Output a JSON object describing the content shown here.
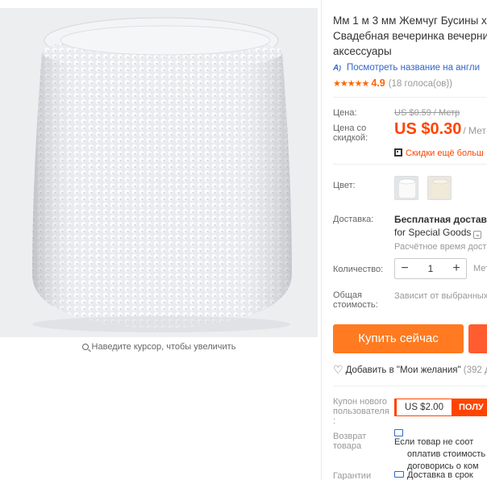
{
  "product": {
    "title_lines": [
      "Мм 1 м 3 мм Жемчуг Бусины х...",
      "Свадебная вечеринка вечерни",
      "аксессуары"
    ],
    "translate_link": "Посмотреть название на англи",
    "rating_score": "4.9",
    "rating_votes": "(18 голоса(ов))",
    "rating_stars": "★★★★★"
  },
  "price": {
    "label": "Цена:",
    "original": "US $0.59 / Метр",
    "discount_label_line1": "Цена со",
    "discount_label_line2": "скидкой:",
    "current": "US $0.30",
    "unit": "/ Мет",
    "extra_discount": "Скидки ещё больш"
  },
  "color": {
    "label": "Цвет:",
    "swatches": [
      "white-pearl",
      "ivory-pearl"
    ]
  },
  "shipping": {
    "label": "Доставка:",
    "line1": "Бесплатная доставка",
    "line2": "for Special Goods",
    "line3": "Расчётное время доста"
  },
  "quantity": {
    "label": "Количество:",
    "value": "1",
    "minus": "−",
    "plus": "+",
    "available": "Мет"
  },
  "total": {
    "label_line1": "Общая",
    "label_line2": "стоимость:",
    "value": "Зависит от выбранных"
  },
  "actions": {
    "buy_now": "Купить сейчас",
    "wishlist": "Добавить в \"Мои желания\"",
    "wishlist_count": "(392 д"
  },
  "coupon": {
    "label_line1": "Купон нового",
    "label_line2": "пользователя",
    "label_line3": ":",
    "amount": "US $2.00",
    "get": "ПОЛУ"
  },
  "returns": {
    "label_line1": "Возврат",
    "label_line2": "товара",
    "line1": "Если товар не соот",
    "line2": "оплатив стоимость",
    "line3": "договорись о ком"
  },
  "guarantee": {
    "label": "Гарантии",
    "text": "Доставка в срок"
  },
  "gallery": {
    "zoom_hint": "Наведите курсор, чтобы увеличить"
  }
}
